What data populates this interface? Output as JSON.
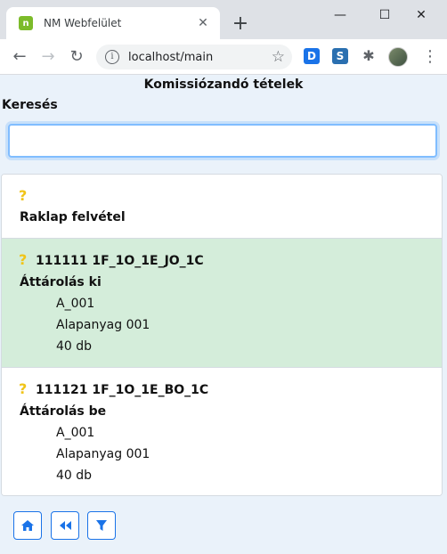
{
  "browser": {
    "tab_title": "NM Webfelület",
    "favicon_letter": "n",
    "url": "localhost/main",
    "ext_d": "D",
    "ext_s": "S"
  },
  "page": {
    "title": "Komissiózandó tételek",
    "search_label": "Keresés",
    "search_value": "",
    "search_placeholder": ""
  },
  "items": [
    {
      "icon": "?",
      "code": "",
      "type": "Raklap felvétel",
      "details": []
    },
    {
      "icon": "?",
      "code": "111111 1F_1O_1E_JO_1C",
      "type": "Áttárolás ki",
      "details": [
        "A_001",
        "Alapanyag 001",
        "40 db"
      ],
      "highlight": true
    },
    {
      "icon": "?",
      "code": "111121 1F_1O_1E_BO_1C",
      "type": "Áttárolás be",
      "details": [
        "A_001",
        "Alapanyag 001",
        "40 db"
      ]
    }
  ],
  "footer": {
    "buttons": [
      "home-icon",
      "rewind-icon",
      "filter-icon"
    ]
  },
  "colors": {
    "accent": "#1a73e8",
    "highlight_row": "#d4edda",
    "question_icon": "#f0c419",
    "page_bg": "#eaf2fa"
  }
}
